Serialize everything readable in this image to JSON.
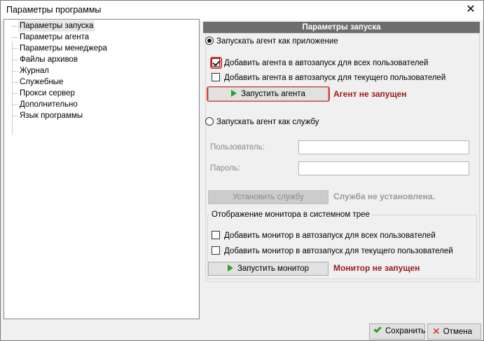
{
  "window": {
    "title": "Параметры программы",
    "close_glyph": "✕"
  },
  "tree": {
    "items": [
      {
        "label": "Параметры запуска",
        "selected": true
      },
      {
        "label": "Параметры агента"
      },
      {
        "label": "Параметры менеджера"
      },
      {
        "label": "Файлы архивов"
      },
      {
        "label": "Журнал"
      },
      {
        "label": "Служебные"
      },
      {
        "label": "Прокси сервер"
      },
      {
        "label": "Дополнительно"
      },
      {
        "label": "Язык программы"
      }
    ]
  },
  "panel": {
    "header": "Параметры запуска",
    "app_mode": {
      "label": "Запускать агент как приложение",
      "selected": true,
      "autostart_all": {
        "label": "Добавить агента в автозапуск для всех пользователей",
        "checked": true
      },
      "autostart_current": {
        "label": "Добавить агента в автозапуск для текущего пользователей",
        "checked": false
      },
      "start_button": "Запустить агента",
      "status": "Агент не запущен"
    },
    "service_mode": {
      "label": "Запускать агент как службу",
      "selected": false,
      "user_label": "Пользователь:",
      "user_value": "",
      "password_label": "Пароль:",
      "password_value": "",
      "install_button": "Установить службу",
      "status": "Служба не установлена."
    },
    "monitor": {
      "title": "Отображение монитора в системном трее",
      "autostart_all": {
        "label": "Добавить монитор в автозапуск для всех пользователей",
        "checked": false
      },
      "autostart_current": {
        "label": "Добавить монитор в автозапуск для текущего пользователей",
        "checked": false
      },
      "start_button": "Запустить монитор",
      "status": "Монитор не запущен"
    }
  },
  "footer": {
    "save": "Сохранить",
    "cancel": "Отмена"
  },
  "colors": {
    "header_bg": "#6d6d6d",
    "status_red": "#9b1a1a",
    "highlight_frame": "#e53935",
    "play_icon": "#2e9e2e"
  }
}
